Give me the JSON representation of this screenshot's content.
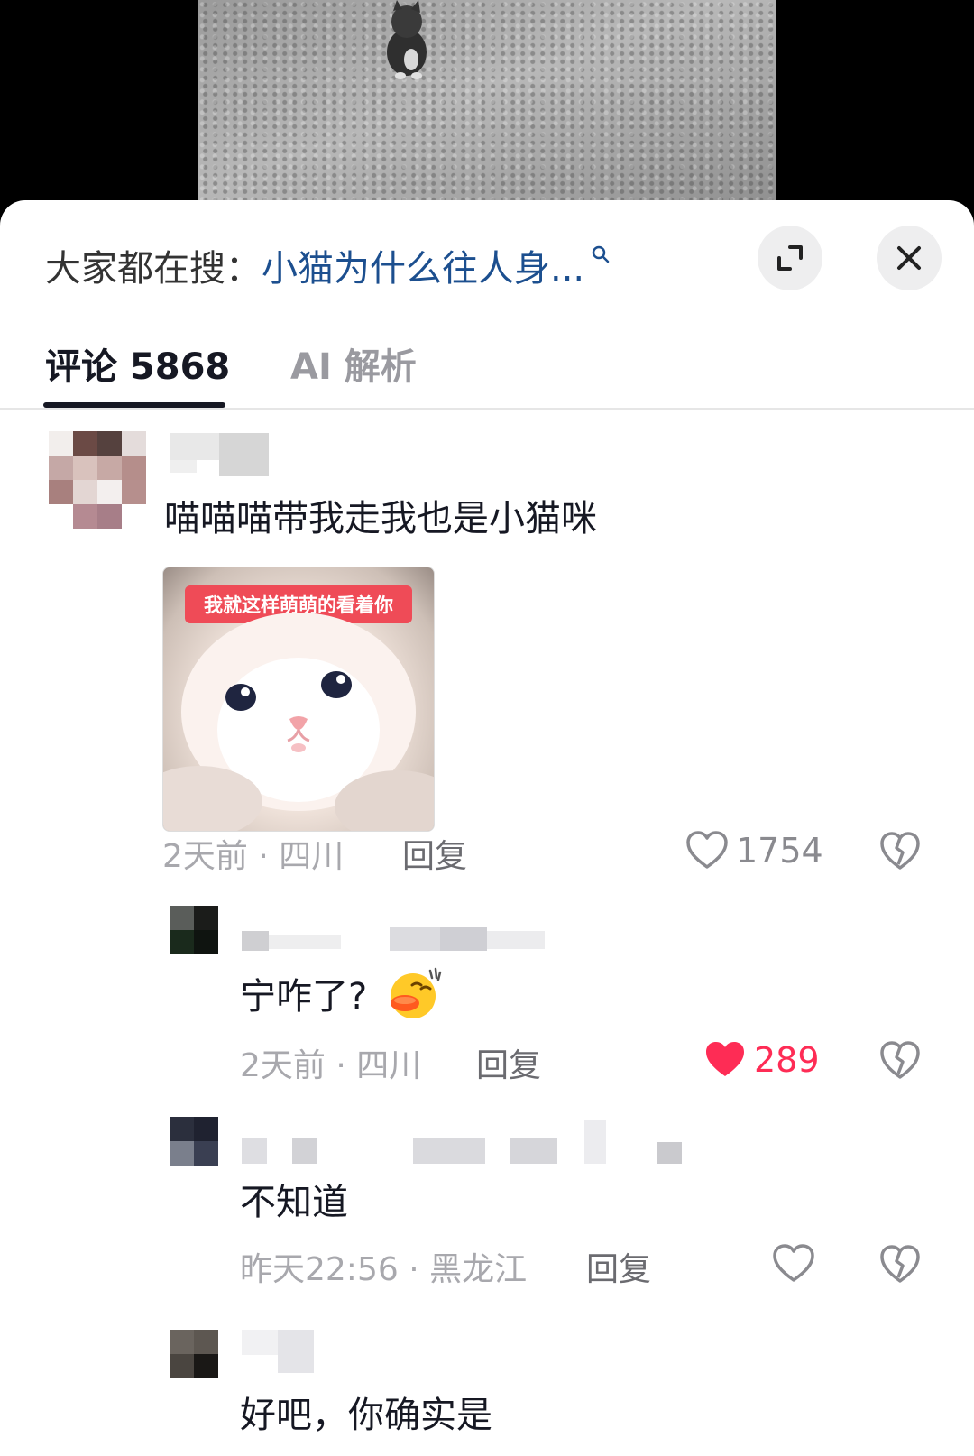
{
  "search": {
    "prefix": "大家都在搜：",
    "query": "小猫为什么往人身..."
  },
  "tabs": {
    "comments_label": "评论 5868",
    "ai_label": "AI 解析"
  },
  "comments": [
    {
      "text": "喵喵喵带我走我也是小猫咪",
      "sticker_caption": "我就这样萌萌的看着你",
      "meta": "2天前 · 四川",
      "reply_label": "回复",
      "likes": "1754",
      "liked": false
    },
    {
      "text": "宁咋了?",
      "emoji_icon": "duck-lips-emoji-icon",
      "meta": "2天前 · 四川",
      "reply_label": "回复",
      "likes": "289",
      "liked": true
    },
    {
      "text": "不知道",
      "meta": "昨天22:56 · 黑龙江",
      "reply_label": "回复",
      "likes": "",
      "liked": false
    },
    {
      "text": "好吧，你确实是"
    }
  ],
  "colors": {
    "search_query": "#1c4f8f",
    "liked": "#fe2c55",
    "sticker_caption_bg": "#ef4b57"
  }
}
